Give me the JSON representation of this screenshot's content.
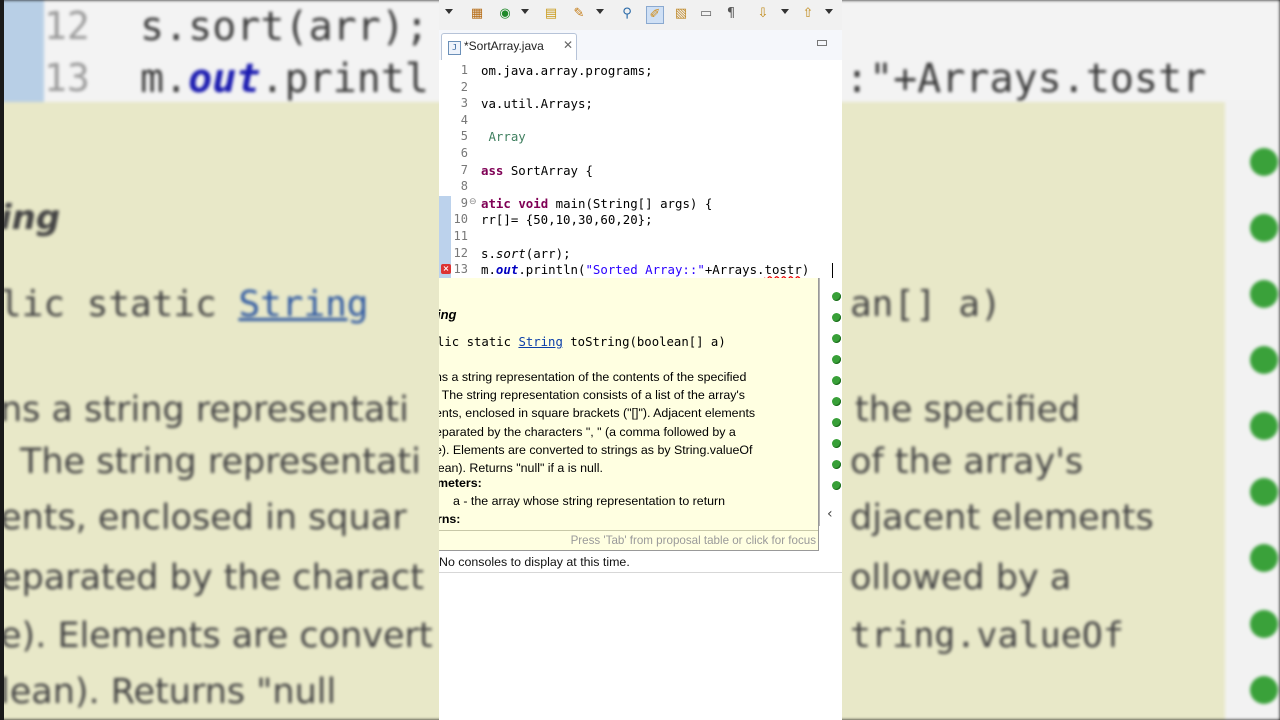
{
  "background": {
    "line12_num": "12",
    "line12_text": "s.sort(arr);",
    "line13_num": "13",
    "line13_text_a": "m.",
    "line13_text_b": "out",
    "line13_text_c": ".printl",
    "line13_text_d": ":\"+Arrays.tostr",
    "title_fragment": "ing",
    "sig_left": "lic static",
    "sig_link": "String",
    "sig_right": "an[] a)",
    "lines_left": [
      "ns a string representati",
      "The string representati",
      "ents, enclosed in squar",
      "eparated by the charact",
      "e). Elements are convert",
      "lean). Returns \"null"
    ],
    "lines_right": [
      "the specified",
      "of the array's",
      "djacent elements",
      "ollowed by a",
      "tring.valueOf",
      ""
    ]
  },
  "editor_tab": {
    "label": "*SortArray.java",
    "close_icon": "close-icon"
  },
  "code_lines": [
    {
      "num": "1",
      "segments": [
        {
          "t": "om.java.array.programs;",
          "c": ""
        }
      ]
    },
    {
      "num": "2",
      "segments": []
    },
    {
      "num": "3",
      "segments": [
        {
          "t": "va.util.Arrays;",
          "c": ""
        }
      ]
    },
    {
      "num": "4",
      "segments": []
    },
    {
      "num": "5",
      "segments": [
        {
          "t": " Array",
          "c": "cmt"
        }
      ]
    },
    {
      "num": "6",
      "segments": []
    },
    {
      "num": "7",
      "segments": [
        {
          "t": "ass",
          "c": "kw"
        },
        {
          "t": " SortArray {",
          "c": ""
        }
      ]
    },
    {
      "num": "8",
      "segments": []
    },
    {
      "num": "9",
      "fold": "⊖",
      "segments": [
        {
          "t": "atic",
          "c": "kw"
        },
        {
          "t": " ",
          "c": ""
        },
        {
          "t": "void",
          "c": "kw"
        },
        {
          "t": " main(String[] ",
          "c": ""
        },
        {
          "t": "args",
          "c": ""
        },
        {
          "t": ") {",
          "c": ""
        }
      ]
    },
    {
      "num": "10",
      "segments": [
        {
          "t": "rr[]= {50,10,30,60,20};",
          "c": ""
        }
      ]
    },
    {
      "num": "11",
      "segments": []
    },
    {
      "num": "12",
      "segments": [
        {
          "t": "s.",
          "c": ""
        },
        {
          "t": "sort",
          "c": "it"
        },
        {
          "t": "(arr);",
          "c": ""
        }
      ]
    },
    {
      "num": "13",
      "error": true,
      "segments": [
        {
          "t": "m.",
          "c": ""
        },
        {
          "t": "out",
          "c": "fld"
        },
        {
          "t": ".println(",
          "c": ""
        },
        {
          "t": "\"Sorted Array::\"",
          "c": "str"
        },
        {
          "t": "+Arrays.",
          "c": ""
        },
        {
          "t": "tostr",
          "c": "squiggle"
        },
        {
          "t": ")",
          "c": ""
        }
      ]
    }
  ],
  "javadoc": {
    "title": "ing",
    "sig_prefix": "lic static ",
    "sig_link": "String",
    "sig_suffix": " toString(boolean[] a)",
    "desc_lines": [
      "ns a string representation of the contents of the specified",
      ". The string representation consists of a list of the array's",
      "ents, enclosed in square brackets (\"[]\"). Adjacent elements",
      "eparated by the characters \",  \" (a comma followed by a",
      "e). Elements are converted to strings as by String.valueOf",
      "lean). Returns \"null\" if a is null."
    ],
    "params_heading": "meters:",
    "param_text": "a - the array whose string representation to return",
    "returns_heading": "rns:",
    "hint": "Press 'Tab' from proposal table or click for focus"
  },
  "console": {
    "message": "No consoles to display at this time."
  },
  "colors": {
    "keyword": "#7f0055",
    "string": "#2a00ff",
    "comment": "#3f7f5f",
    "field": "#0000c0",
    "javadoc_bg": "#ffffe1"
  }
}
